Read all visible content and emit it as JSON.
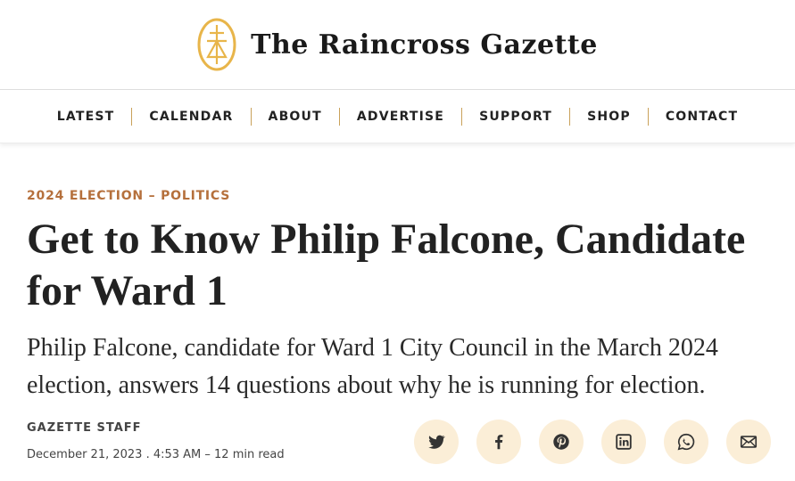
{
  "site": {
    "name": "The Raincross Gazette",
    "accent_color": "#e8b54a",
    "brand_icon": "raincross-emblem-icon"
  },
  "nav": {
    "items": [
      "LATEST",
      "CALENDAR",
      "ABOUT",
      "ADVERTISE",
      "SUPPORT",
      "SHOP",
      "CONTACT"
    ],
    "separator_color": "#c9a15a"
  },
  "article": {
    "kicker": "2024 ELECTION – POLITICS",
    "kicker_color": "#b5703c",
    "headline": "Get to Know Philip Falcone, Candidate for Ward 1",
    "dek": "Philip Falcone, candidate for Ward 1 City Council in the March 2024 election, answers 14 questions about why he is running for election.",
    "author": "GAZETTE STAFF",
    "dateline": "December 21, 2023 . 4:53 AM – 12 min read"
  },
  "share": {
    "button_bg": "#fbeed7",
    "icons": [
      "twitter-icon",
      "facebook-icon",
      "pinterest-icon",
      "linkedin-icon",
      "whatsapp-icon",
      "email-icon"
    ]
  }
}
